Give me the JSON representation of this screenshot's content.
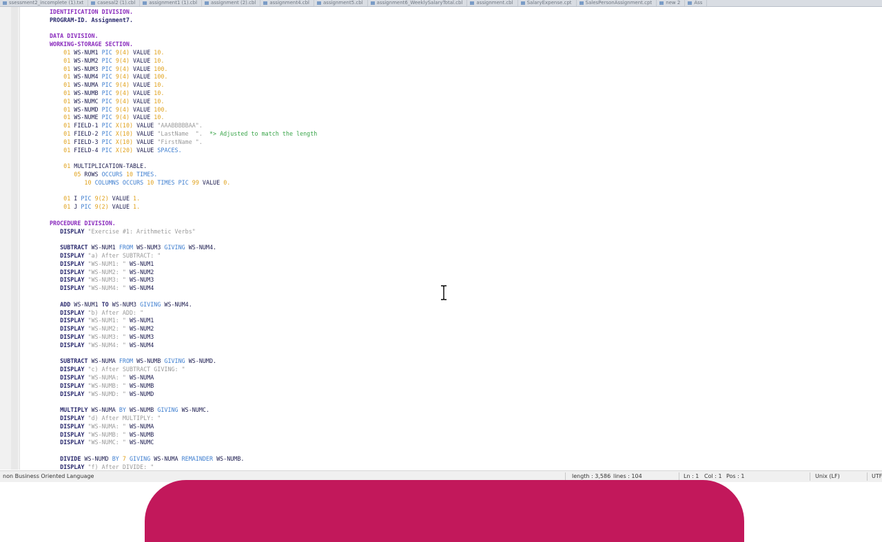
{
  "tabs": [
    "ssessment2_incomplete (1).txt",
    "casesal2 (1).cbl",
    "assignment1 (1).cbl",
    "assignment (2).cbl",
    "assignment4.cbl",
    "assignment5.cbl",
    "assignment6_WeeklySalaryTotal.cbl",
    "assignment.cbl",
    "SalaryExpense.cpt",
    "SalesPersonAssignment.cpt",
    "new 2",
    "Ass"
  ],
  "code_lines": [
    [
      [
        "IDENTIFICATION DIVISION.",
        "k-div"
      ]
    ],
    [
      [
        "PROGRAM-ID. Assignment7.",
        "k-id"
      ]
    ],
    [],
    [
      [
        "DATA DIVISION.",
        "k-div"
      ]
    ],
    [
      [
        "WORKING-STORAGE SECTION.",
        "k-div"
      ]
    ],
    [
      [
        "    01 ",
        "k-num"
      ],
      [
        "WS-NUM1 ",
        ""
      ],
      [
        "PIC ",
        "k-kw"
      ],
      [
        "9(4) ",
        "k-num"
      ],
      [
        "VALUE ",
        ""
      ],
      [
        "10.",
        "k-num"
      ]
    ],
    [
      [
        "    01 ",
        "k-num"
      ],
      [
        "WS-NUM2 ",
        ""
      ],
      [
        "PIC ",
        "k-kw"
      ],
      [
        "9(4) ",
        "k-num"
      ],
      [
        "VALUE ",
        ""
      ],
      [
        "10.",
        "k-num"
      ]
    ],
    [
      [
        "    01 ",
        "k-num"
      ],
      [
        "WS-NUM3 ",
        ""
      ],
      [
        "PIC ",
        "k-kw"
      ],
      [
        "9(4) ",
        "k-num"
      ],
      [
        "VALUE ",
        ""
      ],
      [
        "100.",
        "k-num"
      ]
    ],
    [
      [
        "    01 ",
        "k-num"
      ],
      [
        "WS-NUM4 ",
        ""
      ],
      [
        "PIC ",
        "k-kw"
      ],
      [
        "9(4) ",
        "k-num"
      ],
      [
        "VALUE ",
        ""
      ],
      [
        "100.",
        "k-num"
      ]
    ],
    [
      [
        "    01 ",
        "k-num"
      ],
      [
        "WS-NUMA ",
        ""
      ],
      [
        "PIC ",
        "k-kw"
      ],
      [
        "9(4) ",
        "k-num"
      ],
      [
        "VALUE ",
        ""
      ],
      [
        "10.",
        "k-num"
      ]
    ],
    [
      [
        "    01 ",
        "k-num"
      ],
      [
        "WS-NUMB ",
        ""
      ],
      [
        "PIC ",
        "k-kw"
      ],
      [
        "9(4) ",
        "k-num"
      ],
      [
        "VALUE ",
        ""
      ],
      [
        "10.",
        "k-num"
      ]
    ],
    [
      [
        "    01 ",
        "k-num"
      ],
      [
        "WS-NUMC ",
        ""
      ],
      [
        "PIC ",
        "k-kw"
      ],
      [
        "9(4) ",
        "k-num"
      ],
      [
        "VALUE ",
        ""
      ],
      [
        "10.",
        "k-num"
      ]
    ],
    [
      [
        "    01 ",
        "k-num"
      ],
      [
        "WS-NUMD ",
        ""
      ],
      [
        "PIC ",
        "k-kw"
      ],
      [
        "9(4) ",
        "k-num"
      ],
      [
        "VALUE ",
        ""
      ],
      [
        "100.",
        "k-num"
      ]
    ],
    [
      [
        "    01 ",
        "k-num"
      ],
      [
        "WS-NUME ",
        ""
      ],
      [
        "PIC ",
        "k-kw"
      ],
      [
        "9(4) ",
        "k-num"
      ],
      [
        "VALUE ",
        ""
      ],
      [
        "10.",
        "k-num"
      ]
    ],
    [
      [
        "    01 ",
        "k-num"
      ],
      [
        "FIELD-1 ",
        ""
      ],
      [
        "PIC ",
        "k-kw"
      ],
      [
        "X(10) ",
        "k-num"
      ],
      [
        "VALUE ",
        ""
      ],
      [
        "\"AAABBBBBAA\".",
        "k-str"
      ]
    ],
    [
      [
        "    01 ",
        "k-num"
      ],
      [
        "FIELD-2 ",
        ""
      ],
      [
        "PIC ",
        "k-kw"
      ],
      [
        "X(10) ",
        "k-num"
      ],
      [
        "VALUE ",
        ""
      ],
      [
        "\"LastName  \".  ",
        "k-str"
      ],
      [
        "*> Adjusted to match the length",
        "k-cmt"
      ]
    ],
    [
      [
        "    01 ",
        "k-num"
      ],
      [
        "FIELD-3 ",
        ""
      ],
      [
        "PIC ",
        "k-kw"
      ],
      [
        "X(10) ",
        "k-num"
      ],
      [
        "VALUE ",
        ""
      ],
      [
        "\"FirstName \".",
        "k-str"
      ]
    ],
    [
      [
        "    01 ",
        "k-num"
      ],
      [
        "FIELD-4 ",
        ""
      ],
      [
        "PIC ",
        "k-kw"
      ],
      [
        "X(20) ",
        "k-num"
      ],
      [
        "VALUE ",
        ""
      ],
      [
        "SPACES.",
        "k-fig"
      ]
    ],
    [],
    [
      [
        "    01 ",
        "k-num"
      ],
      [
        "MULTIPLICATION-TABLE.",
        ""
      ]
    ],
    [
      [
        "       05 ",
        "k-num"
      ],
      [
        "ROWS ",
        ""
      ],
      [
        "OCCURS ",
        "k-kw"
      ],
      [
        "10 ",
        "k-num"
      ],
      [
        "TIMES.",
        "k-kw"
      ]
    ],
    [
      [
        "          10 ",
        "k-num"
      ],
      [
        "COLUMNS ",
        "k-kw"
      ],
      [
        "OCCURS ",
        "k-kw"
      ],
      [
        "10 ",
        "k-num"
      ],
      [
        "TIMES ",
        "k-kw"
      ],
      [
        "PIC ",
        "k-kw"
      ],
      [
        "99 ",
        "k-num"
      ],
      [
        "VALUE ",
        ""
      ],
      [
        "0.",
        "k-num"
      ]
    ],
    [],
    [
      [
        "    01 ",
        "k-num"
      ],
      [
        "I ",
        ""
      ],
      [
        "PIC ",
        "k-kw"
      ],
      [
        "9(2) ",
        "k-num"
      ],
      [
        "VALUE ",
        ""
      ],
      [
        "1.",
        "k-num"
      ]
    ],
    [
      [
        "    01 ",
        "k-num"
      ],
      [
        "J ",
        ""
      ],
      [
        "PIC ",
        "k-kw"
      ],
      [
        "9(2) ",
        "k-num"
      ],
      [
        "VALUE ",
        ""
      ],
      [
        "1.",
        "k-num"
      ]
    ],
    [],
    [
      [
        "PROCEDURE DIVISION.",
        "k-div"
      ]
    ],
    [
      [
        "   DISPLAY ",
        "k-id"
      ],
      [
        "\"Exercise #1: Arithmetic Verbs\"",
        "k-str"
      ]
    ],
    [],
    [
      [
        "   SUBTRACT ",
        "k-id"
      ],
      [
        "WS-NUM1 ",
        ""
      ],
      [
        "FROM ",
        "k-kw"
      ],
      [
        "WS-NUM3 ",
        ""
      ],
      [
        "GIVING ",
        "k-kw"
      ],
      [
        "WS-NUM4.",
        ""
      ]
    ],
    [
      [
        "   DISPLAY ",
        "k-id"
      ],
      [
        "\"a) After SUBTRACT: \"",
        "k-str"
      ]
    ],
    [
      [
        "   DISPLAY ",
        "k-id"
      ],
      [
        "\"WS-NUM1: \" ",
        "k-str"
      ],
      [
        "WS-NUM1",
        ""
      ]
    ],
    [
      [
        "   DISPLAY ",
        "k-id"
      ],
      [
        "\"WS-NUM2: \" ",
        "k-str"
      ],
      [
        "WS-NUM2",
        ""
      ]
    ],
    [
      [
        "   DISPLAY ",
        "k-id"
      ],
      [
        "\"WS-NUM3: \" ",
        "k-str"
      ],
      [
        "WS-NUM3",
        ""
      ]
    ],
    [
      [
        "   DISPLAY ",
        "k-id"
      ],
      [
        "\"WS-NUM4: \" ",
        "k-str"
      ],
      [
        "WS-NUM4",
        ""
      ]
    ],
    [],
    [
      [
        "   ADD ",
        "k-id"
      ],
      [
        "WS-NUM1 ",
        ""
      ],
      [
        "TO ",
        "k-id"
      ],
      [
        "WS-NUM3 ",
        ""
      ],
      [
        "GIVING ",
        "k-kw"
      ],
      [
        "WS-NUM4.",
        ""
      ]
    ],
    [
      [
        "   DISPLAY ",
        "k-id"
      ],
      [
        "\"b) After ADD: \"",
        "k-str"
      ]
    ],
    [
      [
        "   DISPLAY ",
        "k-id"
      ],
      [
        "\"WS-NUM1: \" ",
        "k-str"
      ],
      [
        "WS-NUM1",
        ""
      ]
    ],
    [
      [
        "   DISPLAY ",
        "k-id"
      ],
      [
        "\"WS-NUM2: \" ",
        "k-str"
      ],
      [
        "WS-NUM2",
        ""
      ]
    ],
    [
      [
        "   DISPLAY ",
        "k-id"
      ],
      [
        "\"WS-NUM3: \" ",
        "k-str"
      ],
      [
        "WS-NUM3",
        ""
      ]
    ],
    [
      [
        "   DISPLAY ",
        "k-id"
      ],
      [
        "\"WS-NUM4: \" ",
        "k-str"
      ],
      [
        "WS-NUM4",
        ""
      ]
    ],
    [],
    [
      [
        "   SUBTRACT ",
        "k-id"
      ],
      [
        "WS-NUMA ",
        ""
      ],
      [
        "FROM ",
        "k-kw"
      ],
      [
        "WS-NUMB ",
        ""
      ],
      [
        "GIVING ",
        "k-kw"
      ],
      [
        "WS-NUMD.",
        ""
      ]
    ],
    [
      [
        "   DISPLAY ",
        "k-id"
      ],
      [
        "\"c) After SUBTRACT GIVING: \"",
        "k-str"
      ]
    ],
    [
      [
        "   DISPLAY ",
        "k-id"
      ],
      [
        "\"WS-NUMA: \" ",
        "k-str"
      ],
      [
        "WS-NUMA",
        ""
      ]
    ],
    [
      [
        "   DISPLAY ",
        "k-id"
      ],
      [
        "\"WS-NUMB: \" ",
        "k-str"
      ],
      [
        "WS-NUMB",
        ""
      ]
    ],
    [
      [
        "   DISPLAY ",
        "k-id"
      ],
      [
        "\"WS-NUMD: \" ",
        "k-str"
      ],
      [
        "WS-NUMD",
        ""
      ]
    ],
    [],
    [
      [
        "   MULTIPLY ",
        "k-id"
      ],
      [
        "WS-NUMA ",
        ""
      ],
      [
        "BY ",
        "k-kw"
      ],
      [
        "WS-NUMB ",
        ""
      ],
      [
        "GIVING ",
        "k-kw"
      ],
      [
        "WS-NUMC.",
        ""
      ]
    ],
    [
      [
        "   DISPLAY ",
        "k-id"
      ],
      [
        "\"d) After MULTIPLY: \"",
        "k-str"
      ]
    ],
    [
      [
        "   DISPLAY ",
        "k-id"
      ],
      [
        "\"WS-NUMA: \" ",
        "k-str"
      ],
      [
        "WS-NUMA",
        ""
      ]
    ],
    [
      [
        "   DISPLAY ",
        "k-id"
      ],
      [
        "\"WS-NUMB: \" ",
        "k-str"
      ],
      [
        "WS-NUMB",
        ""
      ]
    ],
    [
      [
        "   DISPLAY ",
        "k-id"
      ],
      [
        "\"WS-NUMC: \" ",
        "k-str"
      ],
      [
        "WS-NUMC",
        ""
      ]
    ],
    [],
    [
      [
        "   DIVIDE ",
        "k-id"
      ],
      [
        "WS-NUMD ",
        ""
      ],
      [
        "BY ",
        "k-kw"
      ],
      [
        "7 ",
        "k-num"
      ],
      [
        "GIVING ",
        "k-kw"
      ],
      [
        "WS-NUMA ",
        ""
      ],
      [
        "REMAINDER ",
        "k-kw"
      ],
      [
        "WS-NUMB.",
        ""
      ]
    ],
    [
      [
        "   DISPLAY ",
        "k-id"
      ],
      [
        "\"f) After DIVIDE: \"",
        "k-str"
      ]
    ]
  ],
  "status": {
    "language": "non Business Oriented Language",
    "length": "length : 3,586",
    "lines": "lines : 104",
    "ln": "Ln : 1",
    "col": "Col : 1",
    "pos": "Pos : 1",
    "eol": "Unix (LF)",
    "encoding": "UTF"
  }
}
